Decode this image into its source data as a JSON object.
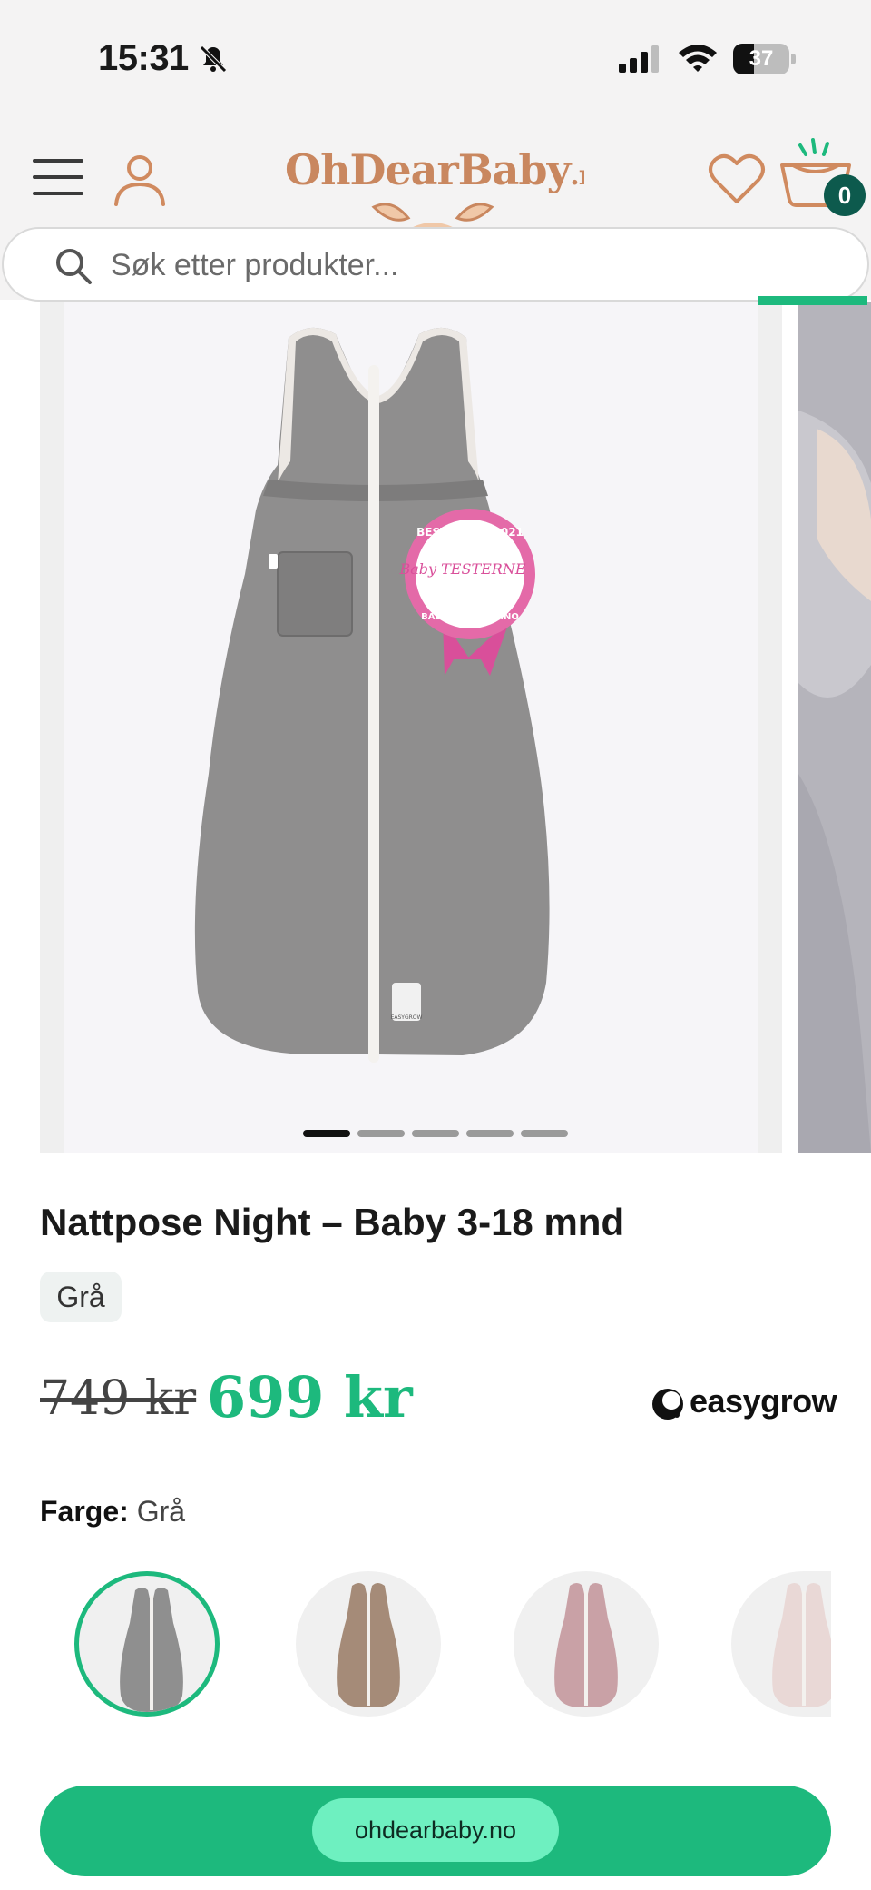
{
  "status_bar": {
    "time": "15:31",
    "battery": "37",
    "battery_level": 0.37
  },
  "header": {
    "logo_name": "OhDearBaby",
    "logo_tld": ".no",
    "cart_count": "0",
    "icons": [
      "menu-icon",
      "user-icon",
      "heart-icon",
      "basket-icon"
    ]
  },
  "search": {
    "placeholder": "Søk etter produkter..."
  },
  "gallery": {
    "slide_count": 5,
    "active_slide": 1,
    "badge_text": {
      "top": "BEST I TEST 2021",
      "middle": "Baby TESTERNE",
      "bottom": "BABYTESTERNE.NO"
    },
    "label_text": "EASYGROW"
  },
  "product": {
    "title": "Nattpose Night – Baby 3-18 mnd",
    "variant_chip": "Grå",
    "price_old": "749 kr",
    "price_new": "699 kr",
    "brand": "easygrow"
  },
  "color_picker": {
    "label": "Farge:",
    "selected": "Grå",
    "swatches": [
      {
        "name": "grey",
        "color": "#8f8f8f",
        "selected": true
      },
      {
        "name": "brown",
        "color": "#a58b78",
        "selected": false
      },
      {
        "name": "pink",
        "color": "#c9a1a6",
        "selected": false
      },
      {
        "name": "pattern",
        "color": "#e9d8d6",
        "selected": false
      }
    ]
  },
  "bottom_bar": {
    "url": "ohdearbaby.no"
  },
  "colors": {
    "accent": "#1db97d",
    "logo": "#c9875f",
    "badge": "#0d5a4d"
  }
}
